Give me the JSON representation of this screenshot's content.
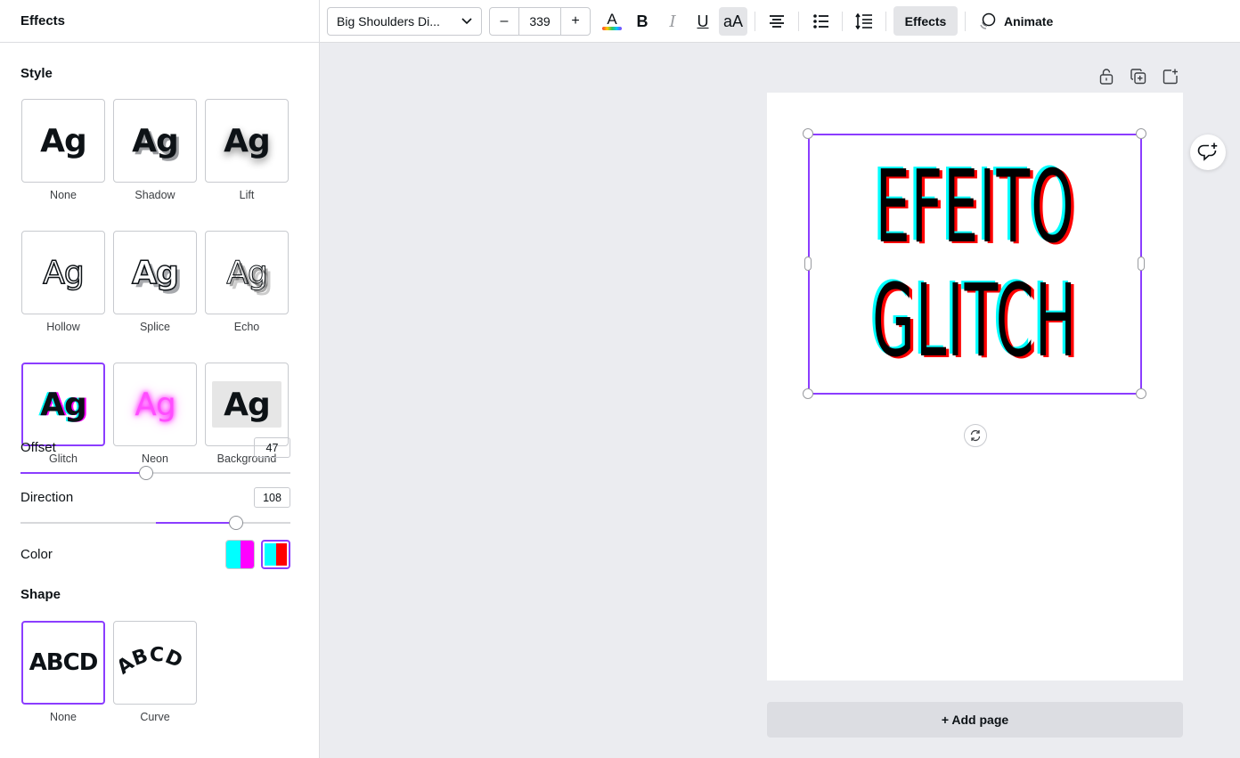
{
  "panel": {
    "title": "Effects",
    "style_title": "Style",
    "styles": [
      {
        "label": "None",
        "glyph": "Ag",
        "variant": "none"
      },
      {
        "label": "Shadow",
        "glyph": "Ag",
        "variant": "shadow"
      },
      {
        "label": "Lift",
        "glyph": "Ag",
        "variant": "lift"
      },
      {
        "label": "Hollow",
        "glyph": "Ag",
        "variant": "hollow"
      },
      {
        "label": "Splice",
        "glyph": "Ag",
        "variant": "splice"
      },
      {
        "label": "Echo",
        "glyph": "Ag",
        "variant": "echo"
      },
      {
        "label": "Glitch",
        "glyph": "Ag",
        "variant": "glitch",
        "selected": true
      },
      {
        "label": "Neon",
        "glyph": "Ag",
        "variant": "neon"
      },
      {
        "label": "Background",
        "glyph": "Ag",
        "variant": "background"
      }
    ],
    "offset": {
      "label": "Offset",
      "value": "47",
      "level": 47
    },
    "direction": {
      "label": "Direction",
      "value": "108",
      "level": 108
    },
    "color": {
      "label": "Color",
      "swatches": [
        {
          "colors": [
            "#00ffff",
            "#ff00ff"
          ],
          "selected": false
        },
        {
          "colors": [
            "#00ffff",
            "#ff0000"
          ],
          "selected": true
        }
      ]
    },
    "shape_title": "Shape",
    "shapes": [
      {
        "label": "None",
        "glyph": "ABCD",
        "selected": true
      },
      {
        "label": "Curve",
        "glyph": "ABCD",
        "selected": false
      }
    ]
  },
  "toolbar": {
    "font_name": "Big Shoulders Di...",
    "font_size": "339",
    "minus": "–",
    "plus": "+",
    "bold": "B",
    "italic": "I",
    "underline": "U",
    "case": "aA",
    "effects_label": "Effects",
    "animate_label": "Animate"
  },
  "canvas": {
    "text_lines": [
      "EFEITO",
      "GLITCH"
    ],
    "add_page_label": "+ Add page"
  },
  "colors": {
    "accent": "#8b3dff",
    "glitch_cyan": "#00ffff",
    "glitch_red": "#ff0000"
  },
  "icons": {
    "chevron": "chevron-down-icon",
    "text_color": "text-color-icon",
    "align": "align-center-icon",
    "list": "bullet-list-icon",
    "spacing": "line-spacing-icon",
    "animate": "animate-icon",
    "lock": "lock-icon",
    "duplicate": "duplicate-page-icon",
    "add": "add-page-icon",
    "rotate": "rotate-icon",
    "comment": "add-comment-icon"
  }
}
